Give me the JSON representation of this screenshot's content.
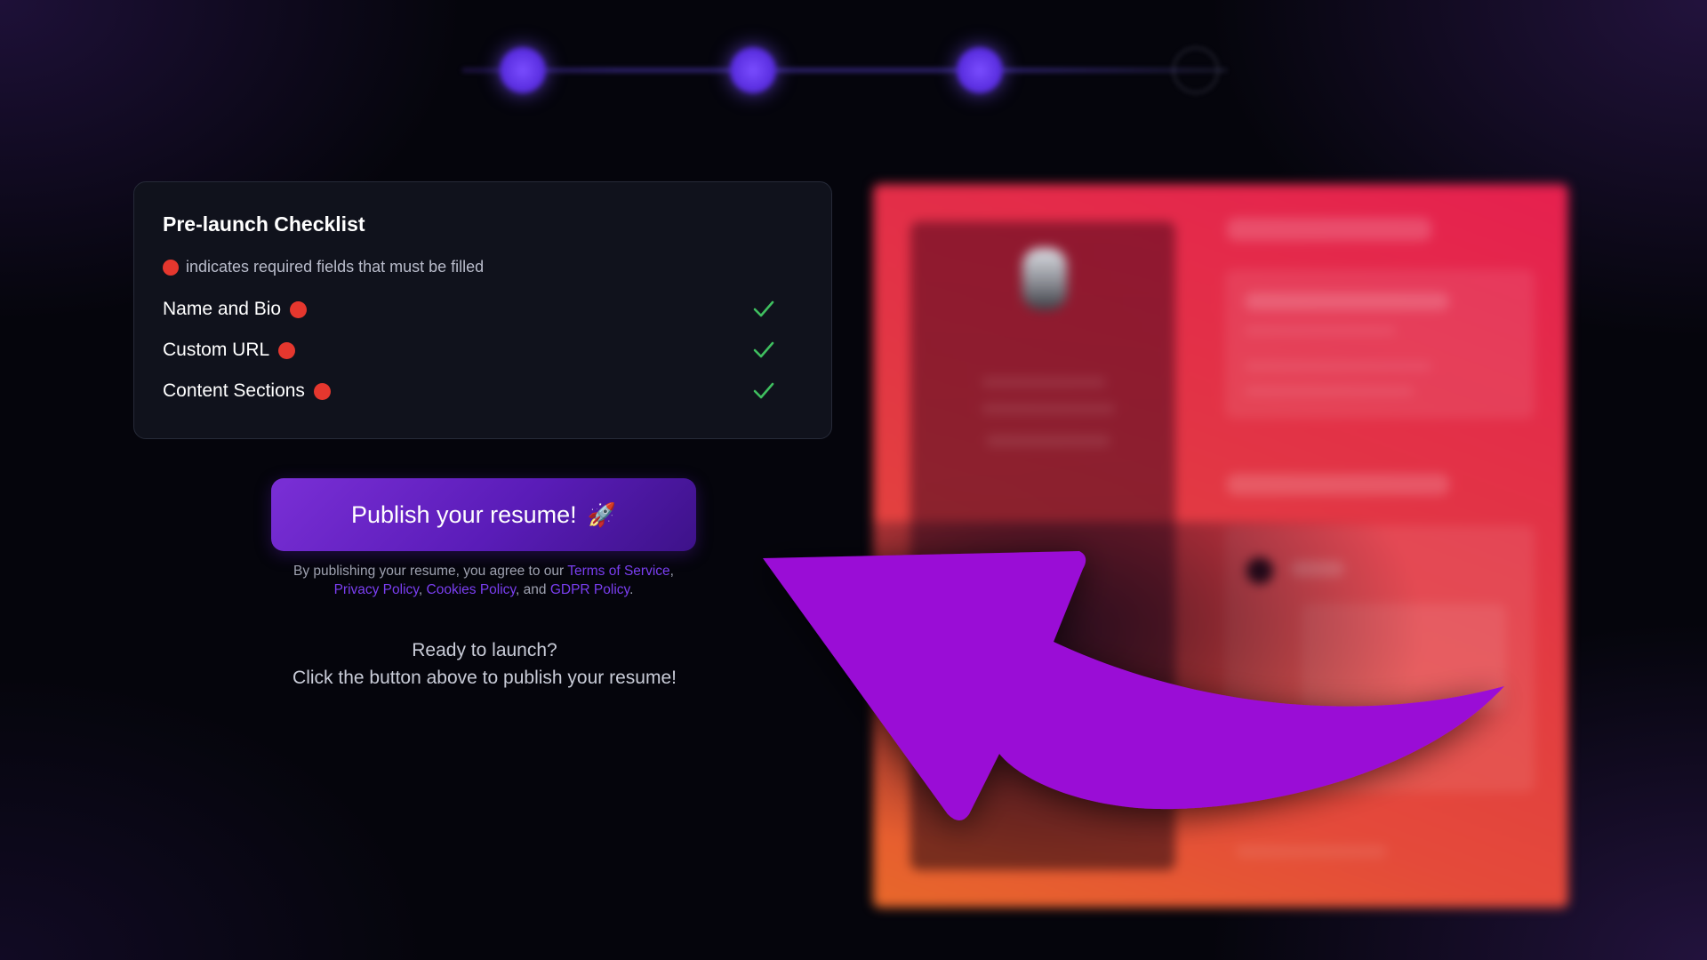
{
  "stepper": {
    "steps": [
      {
        "caption_top": "",
        "caption": "",
        "state": "complete"
      },
      {
        "caption_top": "",
        "caption": "",
        "state": "complete"
      },
      {
        "caption_top": "",
        "caption": "",
        "state": "complete"
      },
      {
        "caption_top": "",
        "caption": "",
        "state": "pending"
      }
    ]
  },
  "checklist": {
    "title": "Pre-launch Checklist",
    "legend": "indicates required fields that must be filled",
    "items": [
      {
        "label": "Name and Bio",
        "required": true,
        "done": true
      },
      {
        "label": "Custom URL",
        "required": true,
        "done": true
      },
      {
        "label": "Content Sections",
        "required": true,
        "done": true
      }
    ]
  },
  "publish": {
    "button_label": "Publish your resume!",
    "button_icon": "🚀",
    "terms_prefix": "By publishing your resume, you agree to our",
    "terms_link": "Terms of Service",
    "privacy_link": "Privacy Policy",
    "cookies_link": "Cookies Policy",
    "and_text": ", and",
    "gdpr_link": "GDPR Policy",
    "ready_line1": "Ready to launch?",
    "ready_line2": "Click the button above to publish your resume!"
  },
  "preview": {
    "name": "",
    "work_heading": "",
    "job_title": "",
    "education_heading": "",
    "school": ""
  },
  "colors": {
    "accent_purple": "#7a3ef0",
    "required_red": "#e5372e",
    "check_green": "#3fbf5f",
    "arrow_purple": "#9a0ad6"
  }
}
